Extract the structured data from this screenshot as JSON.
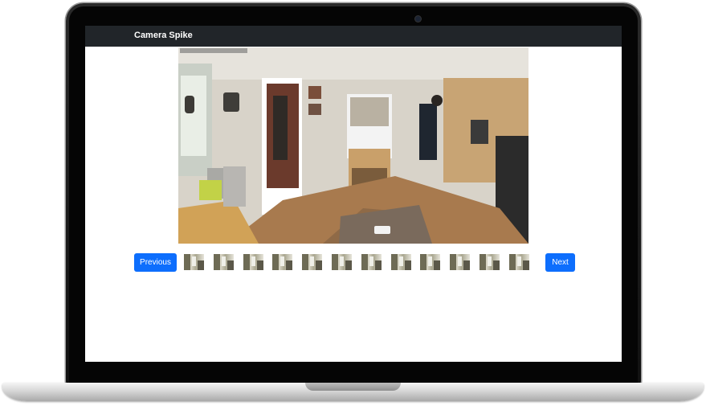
{
  "app": {
    "brand": "Camera Spike"
  },
  "viewer": {
    "thumbnail_count": 12
  },
  "controls": {
    "previous_label": "Previous",
    "next_label": "Next"
  }
}
